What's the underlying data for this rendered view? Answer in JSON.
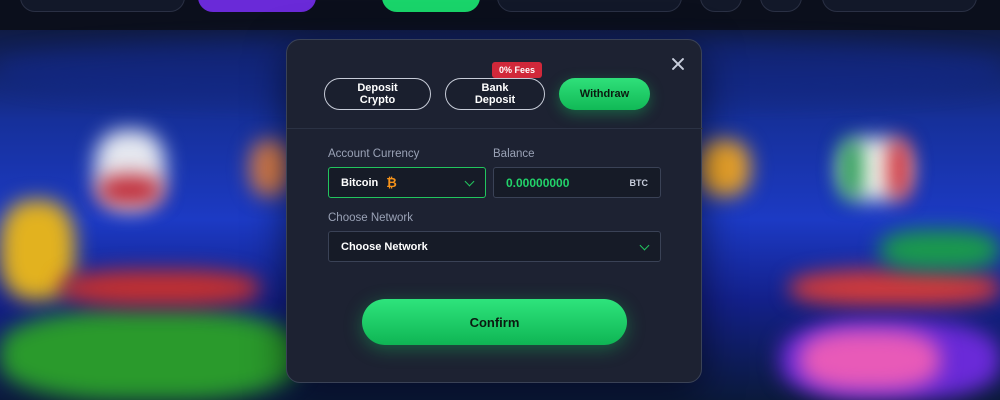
{
  "modal": {
    "tabs": [
      {
        "label": "Deposit\nCrypto",
        "active": false
      },
      {
        "label": "Bank\nDeposit",
        "active": false
      },
      {
        "label": "Withdraw",
        "active": true
      }
    ],
    "fee_badge": "0% Fees",
    "account_currency_label": "Account Currency",
    "currency_value": "Bitcoin",
    "currency_icon": "bitcoin-icon",
    "balance_label": "Balance",
    "balance_value": "0.00000000",
    "balance_unit": "BTC",
    "network_label": "Choose Network",
    "network_value": "Choose Network",
    "confirm_label": "Confirm"
  },
  "colors": {
    "accent_green": "#22c55e",
    "badge_red": "#d1283a",
    "modal_bg": "#1d2232"
  }
}
